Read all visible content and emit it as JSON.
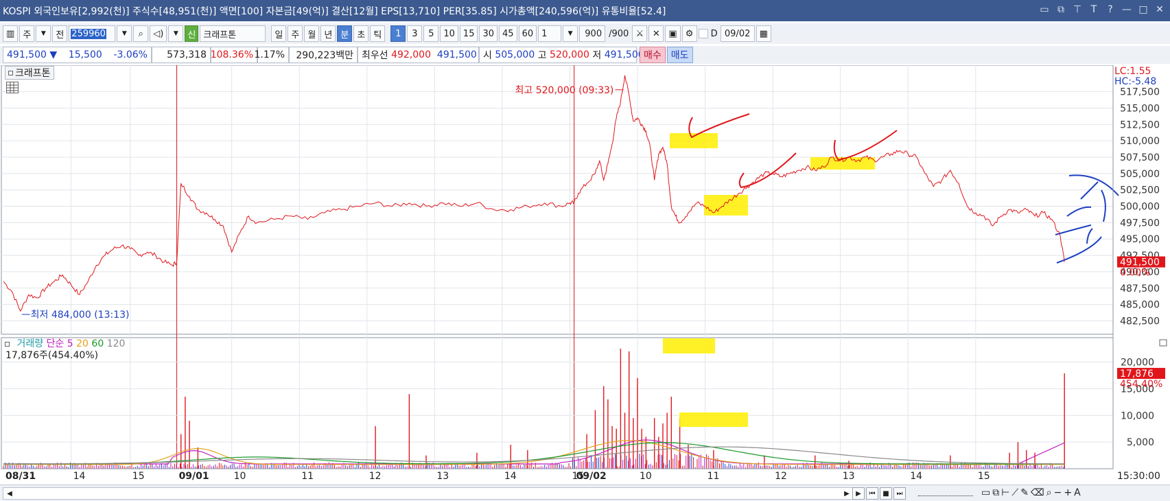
{
  "window": {
    "title": "KOSPI 외국인보유[2,992(천)] 주식수[48,951(천)] 액면[100] 자본금[49(억)] 결산[12월] EPS[13,710] PER[35.85] 시가총액[240,596(억)] 유통비율[52.4]",
    "icons": [
      "window-icon",
      "restore-icon",
      "pin-icon",
      "font-icon",
      "help-icon",
      "minimize-icon",
      "maximize-icon",
      "close-icon"
    ]
  },
  "toolbar": {
    "market": "주",
    "scope": "전",
    "code": "259960",
    "new_badge": "신",
    "stock_name": "크래프톤",
    "periods": [
      "일",
      "주",
      "월",
      "년"
    ],
    "intraday_units": [
      "분",
      "초",
      "틱"
    ],
    "selected_unit": "분",
    "minute_values": [
      "1",
      "3",
      "5",
      "10",
      "15",
      "30",
      "45",
      "60"
    ],
    "selected_minute": "1",
    "multiplier": "1",
    "count": "900",
    "count_total": "/900",
    "date_label": "D",
    "date": "09/02"
  },
  "quote": {
    "price": "491,500",
    "change_arrow": "▼",
    "change": "15,500",
    "change_pct": "-3.06%",
    "volume": "573,318",
    "volume_ratio": "108.36%",
    "turnover": "1.17%",
    "amount": "290,223백만",
    "best_label": "최우선",
    "ask": "492,000",
    "bid": "491,500",
    "open_label": "시",
    "open": "505,000",
    "high_label": "고",
    "high": "520,000",
    "low_label": "저",
    "low": "491,500",
    "buy_button": "매수",
    "sell_button": "매도"
  },
  "price_panel": {
    "tab": "크래프톤",
    "lc": "LC:1.55",
    "hc": "HC:-5.48",
    "current_price": "491,500",
    "current_pct": "0.00%",
    "max_annotation": "최고 520,000 (09:33)",
    "min_annotation": "최저 484,000 (13:13)"
  },
  "volume_panel": {
    "legend": [
      {
        "text": "거래량",
        "color": "#1e9aa6"
      },
      {
        "text": "단순",
        "color": "#c21fc2"
      },
      {
        "text": "5",
        "color": "#c21fc2"
      },
      {
        "text": "20",
        "color": "#e3a21a"
      },
      {
        "text": "60",
        "color": "#1a9a2a"
      },
      {
        "text": "120",
        "color": "#888888"
      }
    ],
    "summary": "17,876주(454.40%)",
    "current_volume": "17,876",
    "current_pct": "454.40%"
  },
  "time_axis": {
    "labels": [
      {
        "t": "08/31",
        "bold": true
      },
      {
        "t": "14"
      },
      {
        "t": "15"
      },
      {
        "t": "09/01",
        "bold": true
      },
      {
        "t": "10"
      },
      {
        "t": "11"
      },
      {
        "t": "12"
      },
      {
        "t": "13"
      },
      {
        "t": "14"
      },
      {
        "t": "15"
      },
      {
        "t": "09/02",
        "bold": true
      },
      {
        "t": "10"
      },
      {
        "t": "11"
      },
      {
        "t": "12"
      },
      {
        "t": "13"
      },
      {
        "t": "14"
      },
      {
        "t": "15"
      }
    ],
    "current_time": "15:30:00"
  },
  "chart_data": {
    "type": "line",
    "price_series": {
      "color": "#e0161b",
      "points": [
        [
          0.0,
          488500
        ],
        [
          0.01,
          487000
        ],
        [
          0.02,
          484000
        ],
        [
          0.03,
          486500
        ],
        [
          0.04,
          486000
        ],
        [
          0.05,
          487500
        ],
        [
          0.06,
          488500
        ],
        [
          0.07,
          489500
        ],
        [
          0.08,
          488000
        ],
        [
          0.09,
          486500
        ],
        [
          0.1,
          488500
        ],
        [
          0.11,
          491000
        ],
        [
          0.12,
          492500
        ],
        [
          0.13,
          493500
        ],
        [
          0.14,
          494000
        ],
        [
          0.15,
          493500
        ],
        [
          0.16,
          492500
        ],
        [
          0.17,
          493000
        ],
        [
          0.18,
          492500
        ],
        [
          0.19,
          491500
        ],
        [
          0.2,
          491000
        ],
        [
          0.205,
          491500
        ],
        [
          0.21,
          503500
        ],
        [
          0.22,
          501500
        ],
        [
          0.23,
          499500
        ],
        [
          0.24,
          499000
        ],
        [
          0.25,
          498000
        ],
        [
          0.26,
          497000
        ],
        [
          0.27,
          493000
        ],
        [
          0.28,
          496000
        ],
        [
          0.29,
          498500
        ],
        [
          0.3,
          497500
        ],
        [
          0.32,
          498000
        ],
        [
          0.34,
          498500
        ],
        [
          0.36,
          498000
        ],
        [
          0.38,
          499000
        ],
        [
          0.4,
          499500
        ],
        [
          0.42,
          500000
        ],
        [
          0.44,
          500500
        ],
        [
          0.46,
          500000
        ],
        [
          0.48,
          500500
        ],
        [
          0.5,
          500000
        ],
        [
          0.52,
          500500
        ],
        [
          0.54,
          500000
        ],
        [
          0.56,
          500500
        ],
        [
          0.58,
          499500
        ],
        [
          0.6,
          499500
        ],
        [
          0.62,
          500000
        ],
        [
          0.64,
          500500
        ],
        [
          0.66,
          500000
        ],
        [
          0.67,
          500500
        ],
        [
          0.675,
          500500
        ],
        [
          0.68,
          502000
        ],
        [
          0.69,
          503500
        ],
        [
          0.7,
          505000
        ],
        [
          0.705,
          507000
        ],
        [
          0.71,
          504000
        ],
        [
          0.715,
          506500
        ],
        [
          0.72,
          509500
        ],
        [
          0.725,
          513500
        ],
        [
          0.73,
          516000
        ],
        [
          0.735,
          520000
        ],
        [
          0.74,
          517000
        ],
        [
          0.745,
          513000
        ],
        [
          0.75,
          513500
        ],
        [
          0.755,
          512500
        ],
        [
          0.76,
          511500
        ],
        [
          0.765,
          509000
        ],
        [
          0.77,
          504000
        ],
        [
          0.775,
          508000
        ],
        [
          0.78,
          509000
        ],
        [
          0.785,
          506500
        ],
        [
          0.79,
          500000
        ],
        [
          0.795,
          498500
        ],
        [
          0.8,
          497500
        ],
        [
          0.81,
          499000
        ],
        [
          0.82,
          500500
        ],
        [
          0.83,
          500000
        ],
        [
          0.84,
          499000
        ],
        [
          0.85,
          500000
        ],
        [
          0.86,
          501000
        ],
        [
          0.87,
          502000
        ],
        [
          0.88,
          503000
        ],
        [
          0.89,
          504000
        ],
        [
          0.9,
          505000
        ],
        [
          0.91,
          505000
        ],
        [
          0.92,
          504500
        ],
        [
          0.93,
          505000
        ],
        [
          0.94,
          505500
        ],
        [
          0.95,
          506000
        ],
        [
          0.96,
          505500
        ],
        [
          0.97,
          506000
        ],
        [
          0.98,
          507500
        ],
        [
          0.99,
          507000
        ],
        [
          1.0,
          507500
        ]
      ]
    },
    "extra_price_points": [
      [
        1.01,
        507000
      ],
      [
        1.02,
        507500
      ],
      [
        1.03,
        507000
      ],
      [
        1.04,
        507500
      ],
      [
        1.05,
        508000
      ],
      [
        1.06,
        508500
      ],
      [
        1.07,
        508000
      ],
      [
        1.08,
        507500
      ],
      [
        1.09,
        505000
      ],
      [
        1.1,
        503000
      ],
      [
        1.11,
        504000
      ],
      [
        1.12,
        505500
      ],
      [
        1.13,
        503500
      ],
      [
        1.14,
        500000
      ],
      [
        1.15,
        499000
      ],
      [
        1.16,
        498500
      ],
      [
        1.17,
        497000
      ],
      [
        1.18,
        498500
      ],
      [
        1.19,
        499500
      ],
      [
        1.2,
        499000
      ],
      [
        1.21,
        499500
      ],
      [
        1.22,
        498500
      ],
      [
        1.23,
        499000
      ],
      [
        1.24,
        498000
      ],
      [
        1.25,
        495500
      ],
      [
        1.255,
        491500
      ]
    ],
    "y_axis": {
      "min": 481500,
      "max": 520500,
      "ticks": [
        517500,
        515000,
        512500,
        510000,
        507500,
        505000,
        502500,
        500000,
        497500,
        495000,
        492500,
        490000,
        487500,
        485000,
        482500
      ],
      "tick_labels": [
        "517,500",
        "515,000",
        "512,500",
        "510,000",
        "507,500",
        "505,000",
        "502,500",
        "500,000",
        "497,500",
        "495,000",
        "492,500",
        "490,000",
        "487,500",
        "485,000",
        "482,500"
      ]
    },
    "volume_axis": {
      "min": 0,
      "max": 22000,
      "ticks": [
        20000,
        15000,
        10000,
        5000
      ],
      "tick_labels": [
        "20,000",
        "15,000",
        "10,000",
        "5,000"
      ]
    },
    "volume_spikes": [
      [
        0.21,
        6500
      ],
      [
        0.215,
        13500
      ],
      [
        0.22,
        9000
      ],
      [
        0.23,
        4000
      ],
      [
        0.44,
        8000
      ],
      [
        0.48,
        14000
      ],
      [
        0.5,
        2500
      ],
      [
        0.56,
        3000
      ],
      [
        0.6,
        4500
      ],
      [
        0.62,
        3500
      ],
      [
        0.69,
        6500
      ],
      [
        0.7,
        11000
      ],
      [
        0.71,
        15500
      ],
      [
        0.715,
        13000
      ],
      [
        0.72,
        8000
      ],
      [
        0.725,
        7500
      ],
      [
        0.73,
        22500
      ],
      [
        0.735,
        10500
      ],
      [
        0.74,
        22000
      ],
      [
        0.745,
        9500
      ],
      [
        0.75,
        17000
      ],
      [
        0.755,
        7500
      ],
      [
        0.76,
        6000
      ],
      [
        0.77,
        9500
      ],
      [
        0.775,
        6000
      ],
      [
        0.78,
        8500
      ],
      [
        0.785,
        10500
      ],
      [
        0.79,
        13500
      ],
      [
        0.8,
        9500
      ],
      [
        0.81,
        4500
      ],
      [
        0.84,
        3500
      ],
      [
        0.9,
        2500
      ],
      [
        0.96,
        2500
      ],
      [
        1.0,
        1500
      ],
      [
        1.12,
        2500
      ],
      [
        1.19,
        3000
      ],
      [
        1.2,
        5000
      ],
      [
        1.21,
        3500
      ],
      [
        1.22,
        3000
      ],
      [
        1.255,
        17876
      ]
    ]
  }
}
